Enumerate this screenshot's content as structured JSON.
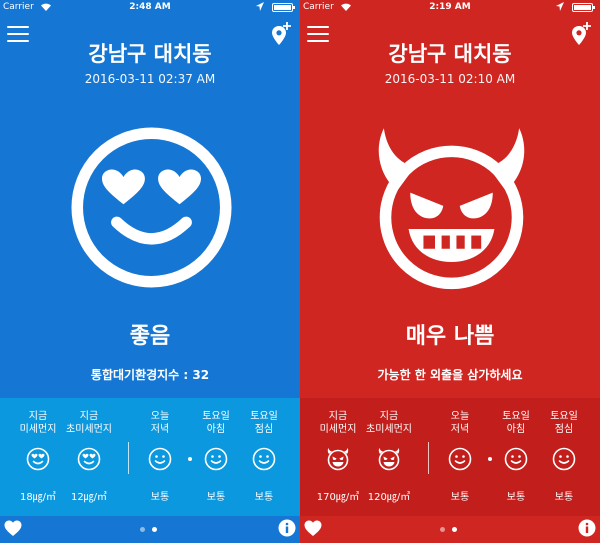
{
  "screens": [
    {
      "status_bar": {
        "carrier": "Carrier",
        "time": "2:48 AM"
      },
      "location": "강남구 대치동",
      "datetime": "2016-03-11 02:37 AM",
      "face_icon": "heart-eyes-smiley-icon",
      "status_label": "좋음",
      "status_sub": "통합대기환경지수 : 32",
      "background_color": "#1577d3",
      "forecast": [
        {
          "label": "지금\n미세먼지",
          "icon": "smiley-icon",
          "value": "18㎍/㎥"
        },
        {
          "label": "지금\n초미세먼지",
          "icon": "smiley-icon",
          "value": "12㎍/㎥"
        },
        {
          "label": "오늘\n저녁",
          "icon": "smiley-icon",
          "value": "보통"
        },
        {
          "label": "토요일\n아침",
          "icon": "smiley-icon",
          "value": "보통"
        },
        {
          "label": "토요일\n점심",
          "icon": "smiley-icon",
          "value": "보통"
        }
      ]
    },
    {
      "status_bar": {
        "carrier": "Carrier",
        "time": "2:19 AM"
      },
      "location": "강남구 대치동",
      "datetime": "2016-03-11 02:10 AM",
      "face_icon": "devil-face-icon",
      "status_label": "매우 나쁨",
      "status_sub": "가능한 한 외출을 삼가하세요",
      "background_color": "#cf2621",
      "forecast": [
        {
          "label": "지금\n미세먼지",
          "icon": "devil-icon",
          "value": "170㎍/㎥"
        },
        {
          "label": "지금\n초미세먼지",
          "icon": "devil-icon",
          "value": "120㎍/㎥"
        },
        {
          "label": "오늘\n저녁",
          "icon": "smiley-icon",
          "value": "보통"
        },
        {
          "label": "토요일\n아침",
          "icon": "smiley-icon",
          "value": "보통"
        },
        {
          "label": "토요일\n점심",
          "icon": "smiley-icon",
          "value": "보통"
        }
      ]
    }
  ]
}
